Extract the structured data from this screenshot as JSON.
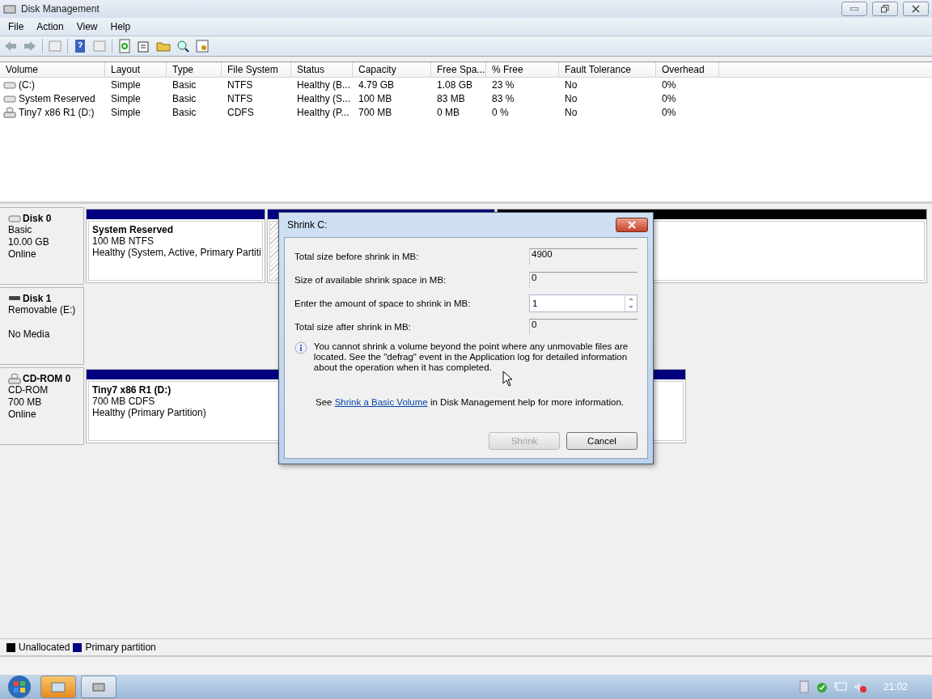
{
  "window": {
    "title": "Disk Management"
  },
  "menu": [
    "File",
    "Action",
    "View",
    "Help"
  ],
  "table": {
    "columns": [
      "Volume",
      "Layout",
      "Type",
      "File System",
      "Status",
      "Capacity",
      "Free Spa...",
      "% Free",
      "Fault Tolerance",
      "Overhead"
    ],
    "rows": [
      {
        "kind": "hdd",
        "cells": [
          "(C:)",
          "Simple",
          "Basic",
          "NTFS",
          "Healthy (B...",
          "4.79 GB",
          "1.08 GB",
          "23 %",
          "No",
          "0%"
        ]
      },
      {
        "kind": "hdd",
        "cells": [
          "System Reserved",
          "Simple",
          "Basic",
          "NTFS",
          "Healthy (S...",
          "100 MB",
          "83 MB",
          "83 %",
          "No",
          "0%"
        ]
      },
      {
        "kind": "cdrom",
        "cells": [
          "Tiny7 x86 R1 (D:)",
          "Simple",
          "Basic",
          "CDFS",
          "Healthy (P...",
          "700 MB",
          "0 MB",
          "0 %",
          "No",
          "0%"
        ]
      }
    ]
  },
  "disks": [
    {
      "kind": "hdd",
      "name": "Disk 0",
      "lines": [
        "Basic",
        "10.00 GB",
        "Online"
      ],
      "partitions": [
        {
          "kind": "primary",
          "selected": false,
          "title": "System Reserved",
          "lines": [
            "100 MB NTFS",
            "Healthy (System, Active, Primary Partiti"
          ]
        },
        {
          "kind": "primary",
          "selected": true
        },
        {
          "kind": "unallocated",
          "selected": false
        }
      ]
    },
    {
      "kind": "removable",
      "name": "Disk 1",
      "lines": [
        "Removable (E:)"
      ],
      "status": "No Media"
    },
    {
      "kind": "cdrom",
      "name": "CD-ROM 0",
      "lines": [
        "CD-ROM",
        "700 MB",
        "Online"
      ],
      "partitions": [
        {
          "kind": "primary",
          "selected": false,
          "title": "Tiny7 x86 R1  (D:)",
          "lines": [
            "700 MB CDFS",
            "Healthy (Primary Partition)"
          ]
        }
      ]
    }
  ],
  "legend": [
    {
      "label": "Unallocated",
      "color": "#000000"
    },
    {
      "label": "Primary partition",
      "color": "#000080"
    }
  ],
  "dialog": {
    "title": "Shrink C:",
    "fields": [
      {
        "kind": "readonly",
        "label": "Total size before shrink in MB:",
        "value": "4900"
      },
      {
        "kind": "readonly",
        "label": "Size of available shrink space in MB:",
        "value": "0"
      },
      {
        "kind": "spinner",
        "label": "Enter the amount of space to shrink in MB:",
        "value": "1"
      },
      {
        "kind": "readonly",
        "label": "Total size after shrink in MB:",
        "value": "0"
      }
    ],
    "info": "You cannot shrink a volume beyond the point where any unmovable files are located. See the \"defrag\" event in the Application log for detailed information about the operation when it has completed.",
    "help": {
      "before": "See ",
      "link": "Shrink a Basic Volume",
      "after": " in Disk Management help for more information."
    },
    "buttons": [
      {
        "label": "Shrink",
        "disabled": true
      },
      {
        "label": "Cancel",
        "disabled": false
      }
    ]
  },
  "taskbar": {
    "clock": "21:02"
  }
}
